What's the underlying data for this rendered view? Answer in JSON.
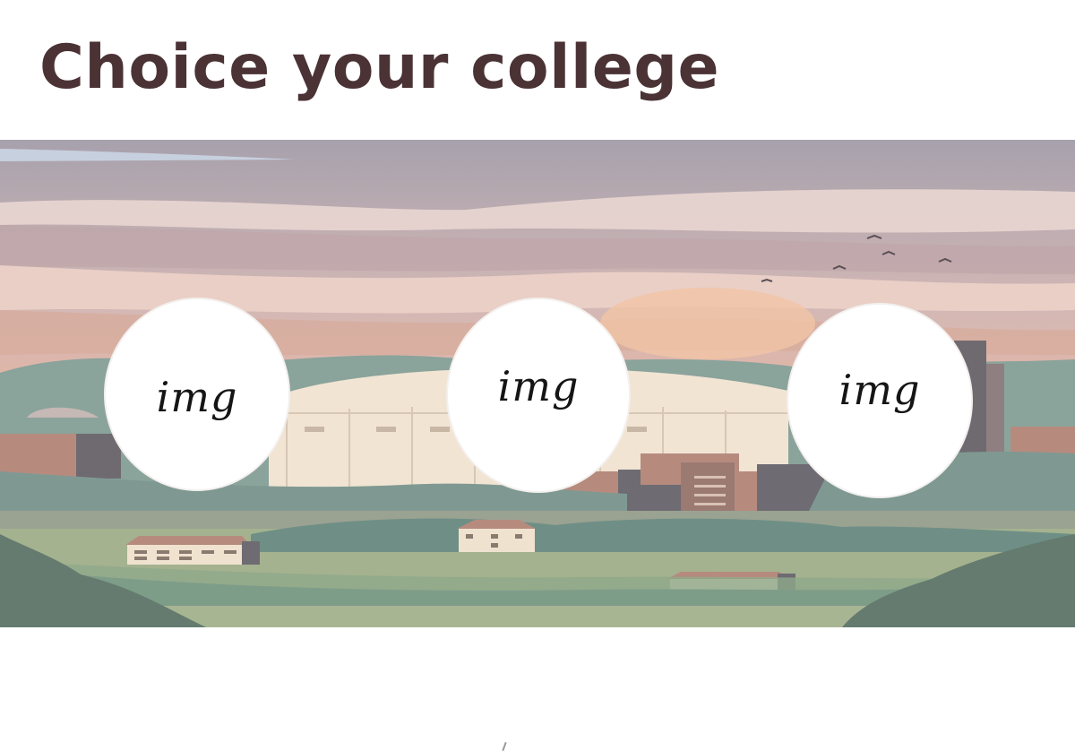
{
  "header": {
    "title": "Choice your college"
  },
  "banner": {
    "illustration": "campus-landscape-dome-stadium",
    "colors": {
      "sky_top": "#a9a2ab",
      "sky_glow": "#e9b9a1",
      "hills": "#7f9a93",
      "dome": "#efe2d2",
      "field": "#9fae8f"
    }
  },
  "colleges": [
    {
      "label": "img"
    },
    {
      "label": "img"
    },
    {
      "label": "img"
    }
  ]
}
